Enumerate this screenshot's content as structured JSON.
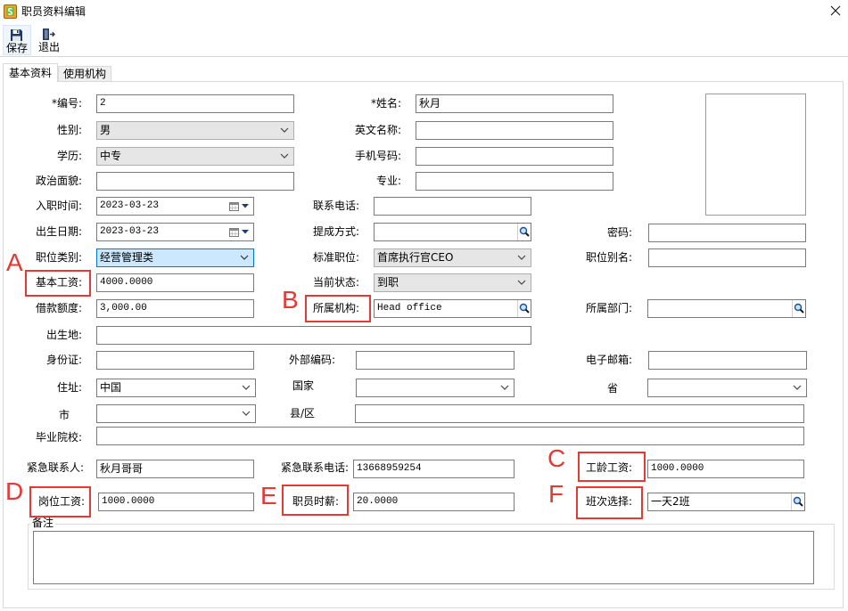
{
  "window": {
    "title": "职员资料编辑"
  },
  "toolbar": {
    "save_label": "保存",
    "exit_label": "退出"
  },
  "icons": {
    "app": "app-icon",
    "close": "close-icon",
    "save": "save-icon",
    "exit": "exit-icon",
    "calendar": "calendar-icon",
    "dropdown": "chevron-down-icon",
    "lookup": "search-icon"
  },
  "tabs": [
    {
      "label": "基本资料",
      "active": true
    },
    {
      "label": "使用机构",
      "active": false
    }
  ],
  "form": {
    "code": {
      "label": "*编号:",
      "value": "2"
    },
    "name": {
      "label": "*姓名:",
      "value": "秋月"
    },
    "gender": {
      "label": "性别:",
      "value": "男"
    },
    "english_name": {
      "label": "英文名称:"
    },
    "education": {
      "label": "学历:",
      "value": "中专"
    },
    "mobile": {
      "label": "手机号码:"
    },
    "political": {
      "label": "政治面貌:"
    },
    "major": {
      "label": "专业:"
    },
    "hire_date": {
      "label": "入职时间:",
      "value": "2023-03-23"
    },
    "phone": {
      "label": "联系电话:"
    },
    "birth_date": {
      "label": "出生日期:",
      "value": "2023-03-23"
    },
    "commission": {
      "label": "提成方式:"
    },
    "password": {
      "label": "密码:"
    },
    "position_category": {
      "label": "职位类别:",
      "value": "经营管理类",
      "focused": true
    },
    "standard_position": {
      "label": "标准职位:",
      "value": "首席执行官CEO"
    },
    "position_alias": {
      "label": "职位别名:"
    },
    "base_salary": {
      "label": "基本工资:",
      "value": "4000.0000"
    },
    "status": {
      "label": "当前状态:",
      "value": "到职"
    },
    "loan_limit": {
      "label": "借款额度:",
      "value": "3,000.00"
    },
    "organization": {
      "label": "所属机构:",
      "value": "Head office"
    },
    "department": {
      "label": "所属部门:"
    },
    "birthplace": {
      "label": "出生地:"
    },
    "id_card": {
      "label": "身份证:"
    },
    "external_code": {
      "label": "外部编码:"
    },
    "email": {
      "label": "电子邮箱:"
    },
    "address": {
      "label": "住址:",
      "value": "中国"
    },
    "country": {
      "label": "国家"
    },
    "province": {
      "label": "省"
    },
    "city": {
      "label": "市"
    },
    "county": {
      "label": "县/区"
    },
    "school": {
      "label": "毕业院校:"
    },
    "emergency_contact": {
      "label": "紧急联系人:",
      "value": "秋月哥哥"
    },
    "emergency_phone": {
      "label": "紧急联系电话:",
      "value": "13668959254"
    },
    "seniority_pay": {
      "label": "工龄工资:",
      "value": "1000.0000"
    },
    "post_salary": {
      "label": "岗位工资:",
      "value": "1000.0000"
    },
    "hourly_wage": {
      "label": "职员时薪:",
      "value": "20.0000"
    },
    "shift": {
      "label": "班次选择:",
      "value": "一天2班"
    },
    "remarks": {
      "label": "备注"
    }
  },
  "annotations": [
    {
      "letter": "A"
    },
    {
      "letter": "B"
    },
    {
      "letter": "C"
    },
    {
      "letter": "D"
    },
    {
      "letter": "E"
    },
    {
      "letter": "F"
    }
  ],
  "colors": {
    "annotation_red": "#e53935",
    "focus_fill": "#cce8ff",
    "focus_border": "#0078d7",
    "readonly_fill": "#e6e6e6",
    "search_blue": "#1a4fa0"
  }
}
